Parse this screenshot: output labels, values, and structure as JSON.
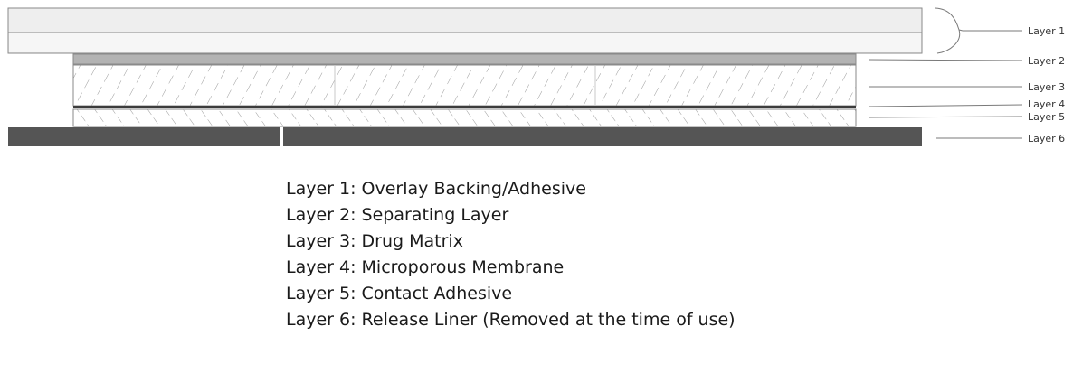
{
  "diagram": {
    "callouts": [
      "Layer 1",
      "Layer 2",
      "Layer 3",
      "Layer 4",
      "Layer 5",
      "Layer 6"
    ]
  },
  "legend": {
    "items": [
      "Layer 1: Overlay Backing/Adhesive",
      "Layer 2: Separating Layer",
      "Layer 3: Drug Matrix",
      "Layer 4: Microporous Membrane",
      "Layer 5: Contact Adhesive",
      "Layer 6: Release Liner (Removed at the time of use)"
    ]
  },
  "colors": {
    "overlay": "#eeeeee",
    "separating": "#b3b3b3",
    "membrane": "#3c3c3c",
    "liner": "#555555",
    "outline": "#8a8a8a",
    "leader": "#7a7a7a"
  }
}
